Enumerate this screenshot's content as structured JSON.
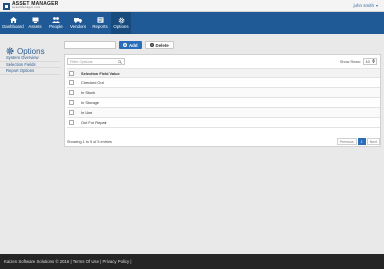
{
  "app": {
    "logo_title": "ASSET MANAGER",
    "logo_sub": "AssetManager.com"
  },
  "user": {
    "name": "john smith"
  },
  "nav": [
    {
      "label": "Dashboard",
      "icon": "home-icon"
    },
    {
      "label": "Assets",
      "icon": "assets-icon"
    },
    {
      "label": "People",
      "icon": "people-icon"
    },
    {
      "label": "Vendors",
      "icon": "vendors-icon"
    },
    {
      "label": "Reports",
      "icon": "reports-icon"
    },
    {
      "label": "Options",
      "icon": "gear-icon",
      "active": true
    }
  ],
  "sidebar": {
    "title": "Options",
    "items": [
      "System Overview",
      "Selection Fields",
      "Report Options"
    ]
  },
  "toolbar": {
    "add_label": "Add",
    "delete_label": "Delete",
    "input_value": ""
  },
  "table": {
    "filter_placeholder": "Filter Options",
    "show_rows_label": "Show Rows:",
    "show_rows_value": "10",
    "column_header": "Selection Field Value",
    "rows": [
      "Checked Out",
      "In Stock",
      "In Storage",
      "In Use",
      "Out For Repair"
    ],
    "summary": "Showing 1 to 5 of 5 entries",
    "prev_label": "Previous",
    "page": "1",
    "next_label": "Next"
  },
  "footer": {
    "text": "Kaizen Software Solutions © 2016 | Terms Of Use | Privacy Policy |"
  },
  "colors": {
    "nav_bg": "#1f5a96",
    "accent": "#2a6ebb",
    "footer_bg": "#252525"
  }
}
